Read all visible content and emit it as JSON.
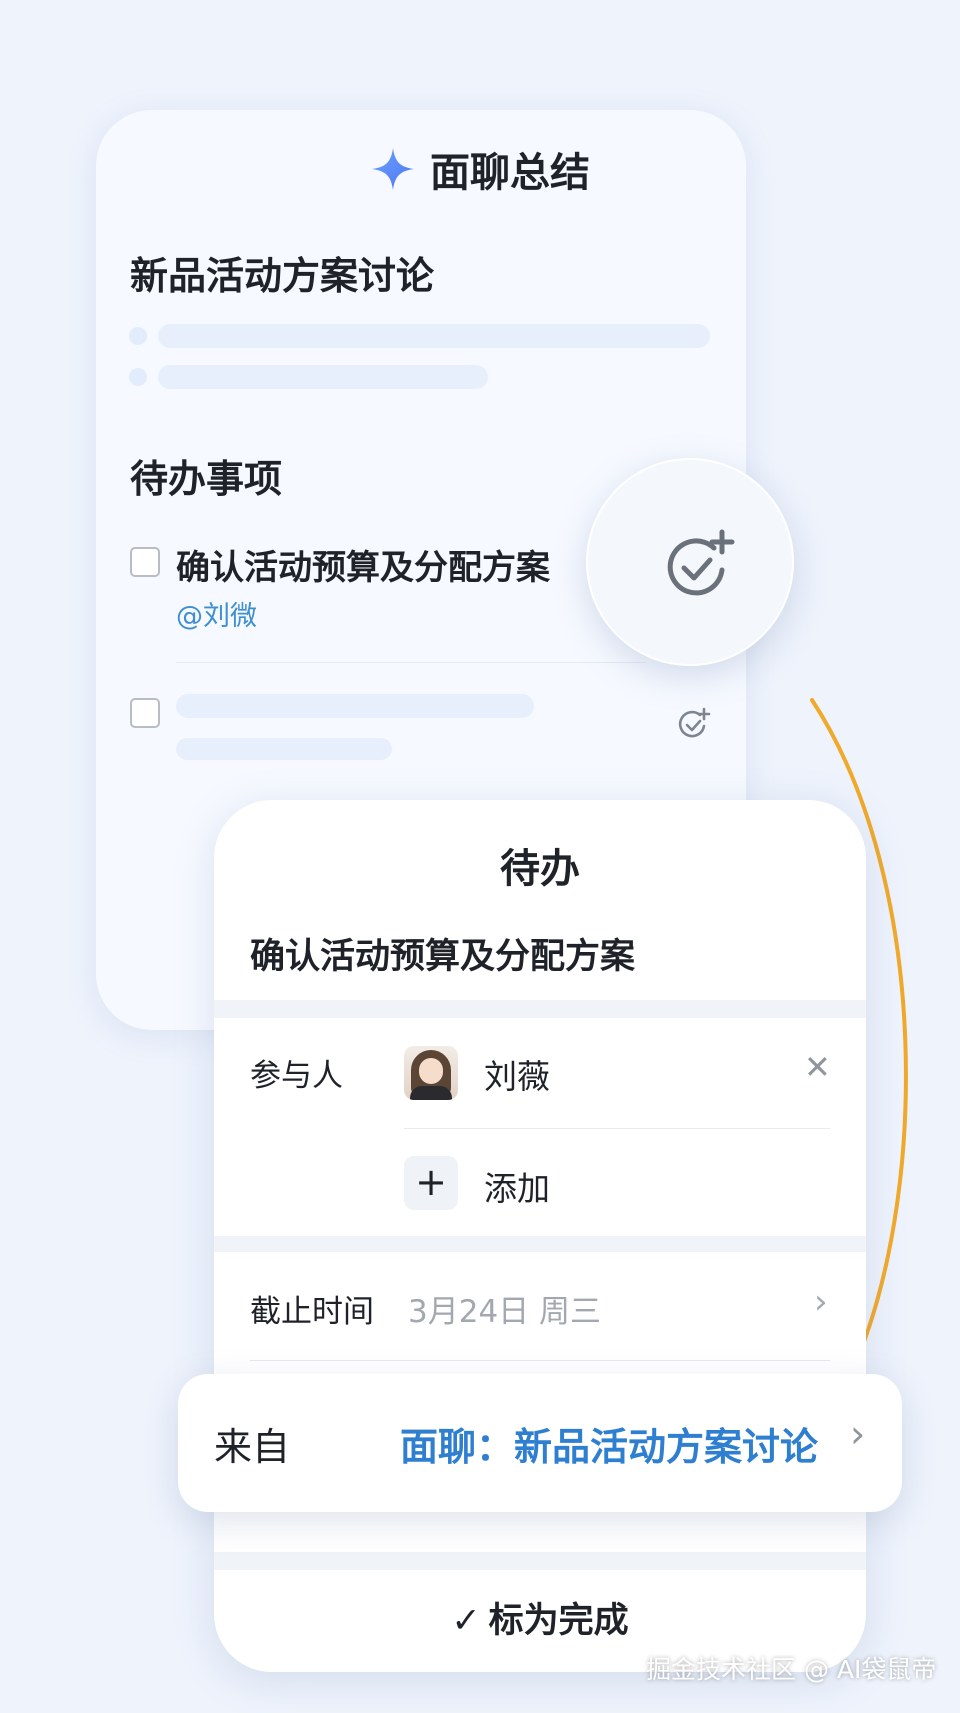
{
  "summary": {
    "title": "面聊总结",
    "meeting_title": "新品活动方案讨论",
    "todo_heading": "待办事项",
    "todo_item": "确认活动预算及分配方案",
    "todo_mention": "@刘微"
  },
  "detail": {
    "title": "待办",
    "item_title": "确认活动预算及分配方案",
    "participants_label": "参与人",
    "participant_name": "刘薇",
    "add_label": "添加",
    "due_label": "截止时间",
    "due_value": "3月24日 周三",
    "done_label": "标为完成"
  },
  "from": {
    "label": "来自",
    "link": "面聊：新品活动方案讨论"
  },
  "watermark": "掘金技术社区 @ AI袋鼠帝",
  "colors": {
    "accent_blue": "#2f7fd1",
    "mention_blue": "#3e8fd0",
    "curve_orange": "#f0a92a",
    "background": "#eef3fc"
  },
  "icons": {
    "sparkle": "sparkle-icon",
    "add_todo": "check-circle-plus-icon",
    "close": "close-icon",
    "add": "plus-icon",
    "chevron": "chevron-right-icon",
    "check": "checkmark-icon"
  }
}
